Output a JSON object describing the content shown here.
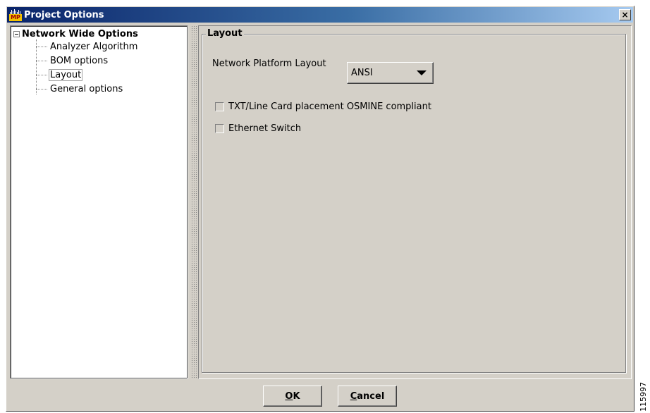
{
  "window": {
    "title": "Project Options",
    "icon_text": "MP",
    "close_symbol": "×",
    "colors": {
      "titlebar_start": "#0a246a",
      "titlebar_end": "#a6caf0",
      "face": "#d4d0c8"
    }
  },
  "tree": {
    "root_label": "Network Wide Options",
    "items": [
      {
        "label": "Analyzer Algorithm"
      },
      {
        "label": "BOM options"
      },
      {
        "label": "Layout",
        "selected": true
      },
      {
        "label": "General options"
      }
    ]
  },
  "layout_group": {
    "title": "Layout",
    "platform_label": "Network Platform Layout",
    "platform_value": "ANSI",
    "checkboxes": [
      {
        "label": "TXT/Line Card placement OSMINE compliant",
        "checked": false
      },
      {
        "label": "Ethernet Switch",
        "checked": false
      }
    ]
  },
  "buttons": {
    "ok_mnemonic": "O",
    "ok_rest": "K",
    "cancel_mnemonic": "C",
    "cancel_rest": "ancel"
  },
  "side_tag": "115997"
}
